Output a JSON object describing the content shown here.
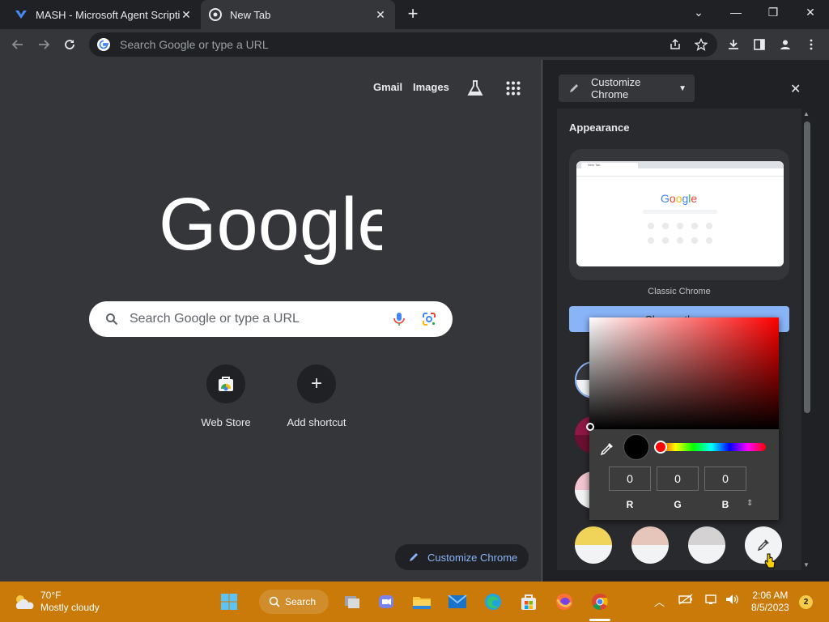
{
  "tabs": [
    {
      "title": "MASH - Microsoft Agent Scripting",
      "close": "✕"
    },
    {
      "title": "New Tab",
      "close": "✕"
    }
  ],
  "window": {
    "new_tab": "+",
    "minimize": "—",
    "restore": "❐",
    "close": "✕",
    "tab_search": "⌄"
  },
  "omnibox": {
    "placeholder": "Search Google or type a URL"
  },
  "ntp": {
    "links": [
      "Gmail",
      "Images"
    ],
    "search_placeholder": "Search Google or type a URL",
    "shortcuts": [
      {
        "label": "Web Store",
        "icon": "webstore-icon"
      },
      {
        "label": "Add shortcut",
        "icon": "plus-icon",
        "glyph": "+"
      }
    ],
    "customize_button": "Customize Chrome"
  },
  "sidepanel": {
    "header": "Customize Chrome",
    "close": "✕",
    "section_title": "Appearance",
    "theme_label": "Classic Chrome",
    "change_theme": "Change theme",
    "preview_tab": "New Tab",
    "preview_logo": "Google"
  },
  "color_picker": {
    "r_value": "0",
    "g_value": "0",
    "b_value": "0",
    "r_label": "R",
    "g_label": "G",
    "b_label": "B",
    "format_toggle": "⇕",
    "current_color": "#000000"
  },
  "swatches": [
    {
      "top": "#f0d45a"
    },
    {
      "top": "#e6c5bb"
    },
    {
      "top": "#d4d2d3"
    }
  ],
  "taskbar": {
    "weather_temp": "70°F",
    "weather_desc": "Mostly cloudy",
    "search_label": "Search",
    "time": "2:06 AM",
    "date": "8/5/2023",
    "notification_count": "2"
  }
}
